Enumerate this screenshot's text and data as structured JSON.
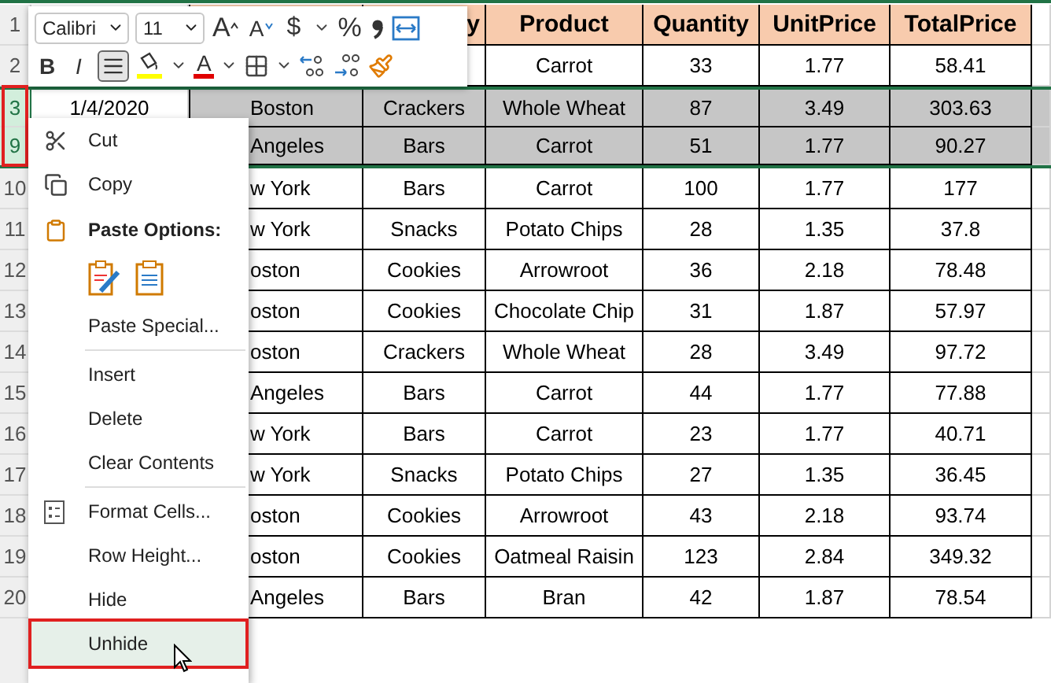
{
  "toolbar": {
    "row_1": [
      {
        "kind": "font",
        "value": "Calibri"
      },
      {
        "kind": "size",
        "value": "11"
      },
      {
        "kind": "grow",
        "label": "A"
      },
      {
        "kind": "shrink",
        "label": "A"
      },
      {
        "kind": "currency",
        "label": "$"
      },
      {
        "kind": "caret"
      },
      {
        "kind": "percent",
        "label": "%"
      },
      {
        "kind": "comma"
      },
      {
        "kind": "wrap"
      }
    ],
    "row_2": [
      {
        "kind": "bold",
        "label": "B",
        "on": false
      },
      {
        "kind": "italic",
        "label": "I",
        "on": false
      },
      {
        "kind": "align",
        "on": true
      },
      {
        "kind": "fill"
      },
      {
        "kind": "caret"
      },
      {
        "kind": "font-color",
        "label": "A"
      },
      {
        "kind": "caret"
      },
      {
        "kind": "borders"
      },
      {
        "kind": "caret"
      },
      {
        "kind": "decrease-decimal"
      },
      {
        "kind": "increase-decimal"
      },
      {
        "kind": "painter"
      }
    ]
  },
  "sheet": {
    "header": {
      "number": "1",
      "cells": {
        "category": "y",
        "product": "Product",
        "quantity": "Quantity",
        "unit_price": "UnitPrice",
        "total_price": "TotalPrice"
      }
    },
    "rows": [
      {
        "number": "2",
        "selected": false,
        "cells": {
          "product": "Carrot",
          "quantity": "33",
          "unit_price": "1.77",
          "total_price": "58.41"
        }
      },
      {
        "number": "3",
        "selected": true,
        "cells": {
          "date": "1/4/2020",
          "city": "Boston",
          "category": "Crackers",
          "product": "Whole Wheat",
          "quantity": "87",
          "unit_price": "3.49",
          "total_price": "303.63"
        }
      },
      {
        "number": "9",
        "selected": true,
        "cells": {
          "city": "Angeles",
          "category": "Bars",
          "product": "Carrot",
          "quantity": "51",
          "unit_price": "1.77",
          "total_price": "90.27"
        }
      },
      {
        "number": "10",
        "selected": false,
        "cells": {
          "city": "w York",
          "category": "Bars",
          "product": "Carrot",
          "quantity": "100",
          "unit_price": "1.77",
          "total_price": "177"
        }
      },
      {
        "number": "11",
        "selected": false,
        "cells": {
          "city": "w York",
          "category": "Snacks",
          "product": "Potato Chips",
          "quantity": "28",
          "unit_price": "1.35",
          "total_price": "37.8"
        }
      },
      {
        "number": "12",
        "selected": false,
        "cells": {
          "city": "oston",
          "category": "Cookies",
          "product": "Arrowroot",
          "quantity": "36",
          "unit_price": "2.18",
          "total_price": "78.48"
        }
      },
      {
        "number": "13",
        "selected": false,
        "cells": {
          "city": "oston",
          "category": "Cookies",
          "product": "Chocolate Chip",
          "quantity": "31",
          "unit_price": "1.87",
          "total_price": "57.97"
        }
      },
      {
        "number": "14",
        "selected": false,
        "cells": {
          "city": "oston",
          "category": "Crackers",
          "product": "Whole Wheat",
          "quantity": "28",
          "unit_price": "3.49",
          "total_price": "97.72"
        }
      },
      {
        "number": "15",
        "selected": false,
        "cells": {
          "city": "Angeles",
          "category": "Bars",
          "product": "Carrot",
          "quantity": "44",
          "unit_price": "1.77",
          "total_price": "77.88"
        }
      },
      {
        "number": "16",
        "selected": false,
        "cells": {
          "city": "w York",
          "category": "Bars",
          "product": "Carrot",
          "quantity": "23",
          "unit_price": "1.77",
          "total_price": "40.71"
        }
      },
      {
        "number": "17",
        "selected": false,
        "cells": {
          "city": "w York",
          "category": "Snacks",
          "product": "Potato Chips",
          "quantity": "27",
          "unit_price": "1.35",
          "total_price": "36.45"
        }
      },
      {
        "number": "18",
        "selected": false,
        "cells": {
          "city": "oston",
          "category": "Cookies",
          "product": "Arrowroot",
          "quantity": "43",
          "unit_price": "2.18",
          "total_price": "93.74"
        }
      },
      {
        "number": "19",
        "selected": false,
        "cells": {
          "city": "oston",
          "category": "Cookies",
          "product": "Oatmeal Raisin",
          "quantity": "123",
          "unit_price": "2.84",
          "total_price": "349.32"
        }
      },
      {
        "number": "20",
        "selected": false,
        "cells": {
          "city": "Angeles",
          "category": "Bars",
          "product": "Bran",
          "quantity": "42",
          "unit_price": "1.87",
          "total_price": "78.54"
        }
      }
    ]
  },
  "context_menu": [
    {
      "kind": "cut",
      "label": "Cut",
      "selected": false
    },
    {
      "kind": "copy",
      "label": "Copy",
      "selected": false
    },
    {
      "kind": "header",
      "label": "Paste Options:"
    },
    {
      "kind": "paste-buttons"
    },
    {
      "kind": "plain",
      "label": "Paste Special...",
      "selected": false
    },
    {
      "kind": "separator"
    },
    {
      "kind": "plain",
      "label": "Insert",
      "selected": false
    },
    {
      "kind": "plain",
      "label": "Delete",
      "selected": false
    },
    {
      "kind": "plain",
      "label": "Clear Contents",
      "selected": false
    },
    {
      "kind": "separator"
    },
    {
      "kind": "format",
      "label": "Format Cells...",
      "selected": false
    },
    {
      "kind": "plain",
      "label": "Row Height...",
      "selected": false
    },
    {
      "kind": "plain",
      "label": "Hide",
      "selected": false
    },
    {
      "kind": "plain",
      "label": "Unhide",
      "selected": true
    }
  ]
}
